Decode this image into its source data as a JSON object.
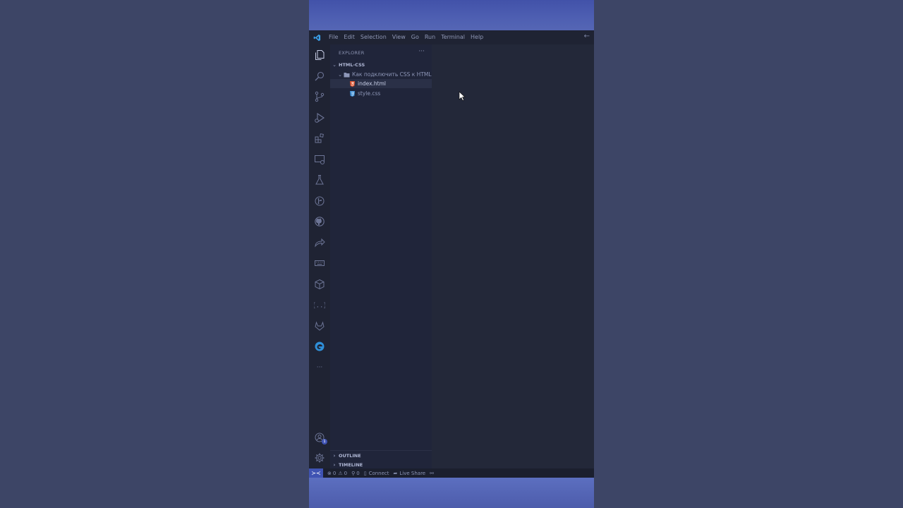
{
  "titlebar": {
    "menu": [
      "File",
      "Edit",
      "Selection",
      "View",
      "Go",
      "Run",
      "Terminal",
      "Help"
    ]
  },
  "sidebar": {
    "title": "EXPLORER",
    "more": "···",
    "workspace": "HTML-CSS",
    "folder": "Как подключить CSS к HTML",
    "files": [
      {
        "name": "index.html",
        "icon": "html-file-icon",
        "selected": true
      },
      {
        "name": "style.css",
        "icon": "css-file-icon",
        "selected": false
      }
    ],
    "outline": "OUTLINE",
    "timeline": "TIMELINE"
  },
  "activity": {
    "accounts_badge": "1",
    "more": "···"
  },
  "statusbar": {
    "errors": "0",
    "warnings": "0",
    "ports": "0",
    "connect": "Connect",
    "live_share": "Live Share"
  },
  "colors": {
    "background": "#3d4566",
    "editor": "#232839",
    "sidebar": "#20253a",
    "accent": "#3f53b3",
    "html_icon": "#e0532e",
    "css_icon": "#3d8fd6"
  }
}
